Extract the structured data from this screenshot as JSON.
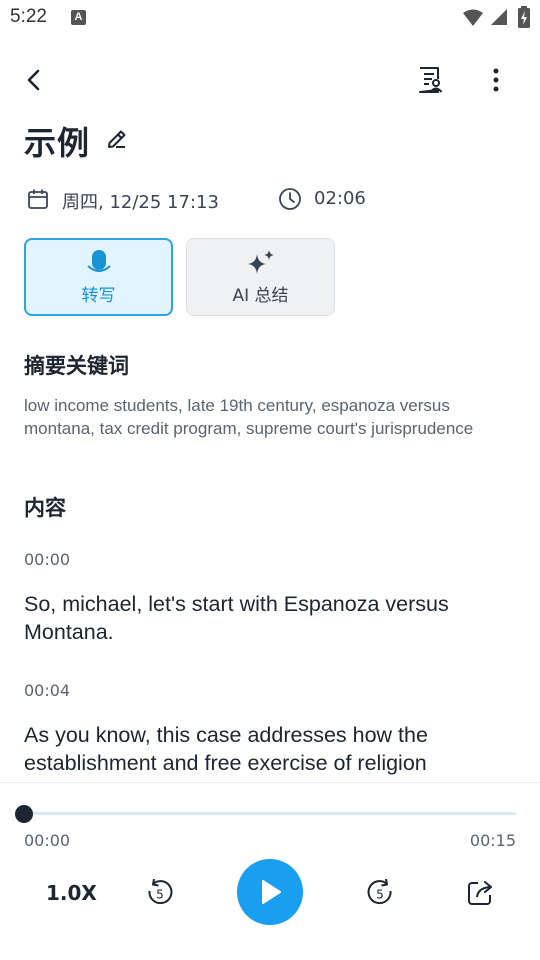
{
  "status_bar": {
    "time": "5:22",
    "notif_badge": "A"
  },
  "header": {
    "title": "示例"
  },
  "meta": {
    "date": "周四, 12/25 17:13",
    "duration": "02:06"
  },
  "tabs": [
    {
      "label": "转写",
      "active": true
    },
    {
      "label": "AI 总结",
      "active": false
    }
  ],
  "summary": {
    "heading": "摘要关键词",
    "keywords": "low income students, late 19th century, espanoza versus montana, tax credit program, supreme court's jurisprudence"
  },
  "content": {
    "heading": "内容",
    "segments": [
      {
        "time": "00:00",
        "text": "So, michael, let's start with Espanoza versus Montana."
      },
      {
        "time": "00:04",
        "text": "As you know, this case addresses how the establishment and free exercise of religion clauses affect when a state or public..."
      }
    ]
  },
  "player": {
    "current_time": "00:00",
    "total_time": "00:15",
    "progress": 0,
    "speed": "1.0X",
    "rewind_seconds": "5",
    "forward_seconds": "5"
  },
  "colors": {
    "accent": "#1a9ef0",
    "tab_active_bg": "#e2f4fd",
    "text_primary": "#1c2530"
  }
}
